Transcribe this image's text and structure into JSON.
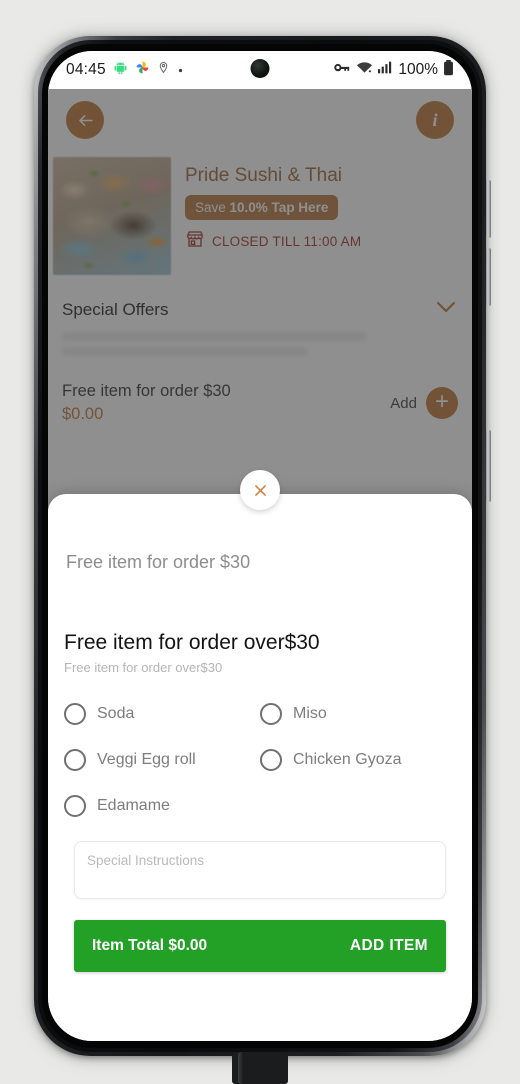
{
  "status_bar": {
    "time": "04:45",
    "battery_percent": "100%",
    "icons": [
      "android-robot-icon",
      "photos-app-icon",
      "location-pin-icon",
      "dot-icon",
      "vpn-key-icon",
      "wifi-icon",
      "cellular-signal-icon",
      "battery-icon"
    ]
  },
  "app_bar": {
    "back_label": "back-arrow",
    "info_label": "i"
  },
  "restaurant": {
    "name": "Pride Sushi & Thai",
    "save_prefix": "Save ",
    "save_value": "10.0% Tap Here",
    "status": "CLOSED TILL 11:00 AM"
  },
  "special_offers": {
    "title": "Special Offers",
    "offer_name": "Free item for order $30",
    "offer_price": "$0.00",
    "add_label": "Add",
    "add_plus": "+"
  },
  "modal": {
    "close_label": "×",
    "sheet_title": "Free item for order $30",
    "item_name": "Free item for order over$30",
    "item_description": "Free item for order over$30",
    "options": [
      {
        "label": "Soda",
        "selected": false
      },
      {
        "label": "Miso",
        "selected": false
      },
      {
        "label": "Veggi Egg roll",
        "selected": false
      },
      {
        "label": "Chicken Gyoza",
        "selected": false
      },
      {
        "label": "Edamame",
        "selected": false
      }
    ],
    "instructions_value": "",
    "instructions_placeholder": "Special Instructions",
    "cta_total": "Item Total $0.00",
    "cta_action": "ADD ITEM"
  },
  "nav_bar": {
    "recents": "recents-icon",
    "home": "home-icon",
    "back": "back-icon"
  },
  "colors": {
    "accent_brown": "#c27b3e",
    "cta_green": "#23a026",
    "closed_red": "#a5392c"
  }
}
